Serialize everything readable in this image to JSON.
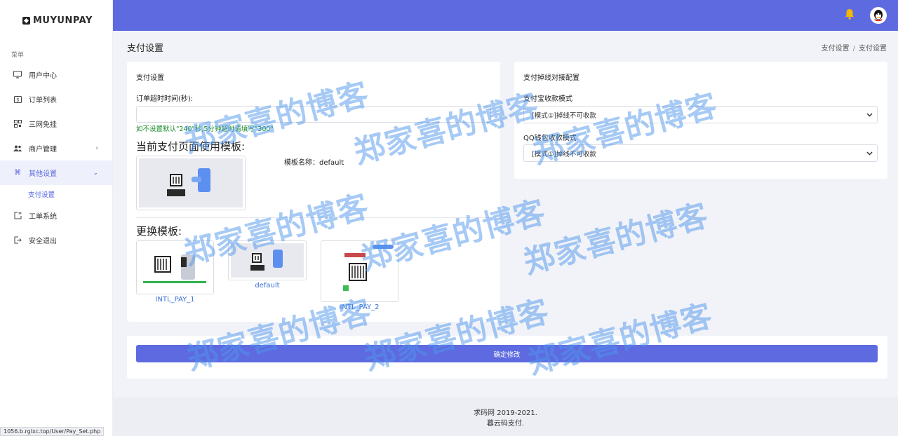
{
  "brand": {
    "name": "MUYUNPAY"
  },
  "sidebar": {
    "menu_title": "菜单",
    "items": [
      {
        "label": "用户中心",
        "icon": "monitor-icon"
      },
      {
        "label": "订单列表",
        "icon": "receipt-icon"
      },
      {
        "label": "三网免挂",
        "icon": "qr-grid-icon"
      },
      {
        "label": "商户管理",
        "icon": "users-icon"
      },
      {
        "label": "其他设置",
        "icon": "command-icon"
      },
      {
        "label": "工单系统",
        "icon": "ticket-icon"
      },
      {
        "label": "安全退出",
        "icon": "logout-icon"
      }
    ],
    "sub_items": [
      {
        "label": "支付设置"
      }
    ]
  },
  "header": {
    "title": "支付设置"
  },
  "breadcrumb": {
    "parent": "支付设置",
    "sep": "/",
    "current": "支付设置"
  },
  "left_card": {
    "title": "支付设置",
    "timeout_label": "订单超时时间(秒):",
    "timeout_value": "",
    "timeout_hint": "如不设置默认\"240\"秒,5分钟超时请填写\"300\"",
    "current_template_title": "当前支付页面使用模板:",
    "template_name_text": "模板名称：default",
    "change_template_title": "更换模板:",
    "templates": [
      {
        "label": "INTL_PAY_1"
      },
      {
        "label": "default"
      },
      {
        "label": "INTL_PAY_2"
      }
    ]
  },
  "right_card": {
    "title": "支付掉线对接配置",
    "alipay_label": "支付宝收款模式",
    "alipay_value": "[模式①]掉线不可收款",
    "qq_label": "QQ钱包收款模式",
    "qq_value": "[模式①]掉线不可收款"
  },
  "submit": {
    "label": "确定修改"
  },
  "footer": {
    "line1": "求码网 2019-2021.",
    "line2": "暮云码支付."
  },
  "status_bar": {
    "url": "1056.b.rglxc.top/User/Pay_Set.php"
  },
  "watermark": {
    "text": "郑家喜的博客"
  },
  "colors": {
    "accent": "#5e6be0",
    "hint": "#1a8a2a",
    "link": "#3a72d8",
    "watermark": "#4d96eb"
  }
}
